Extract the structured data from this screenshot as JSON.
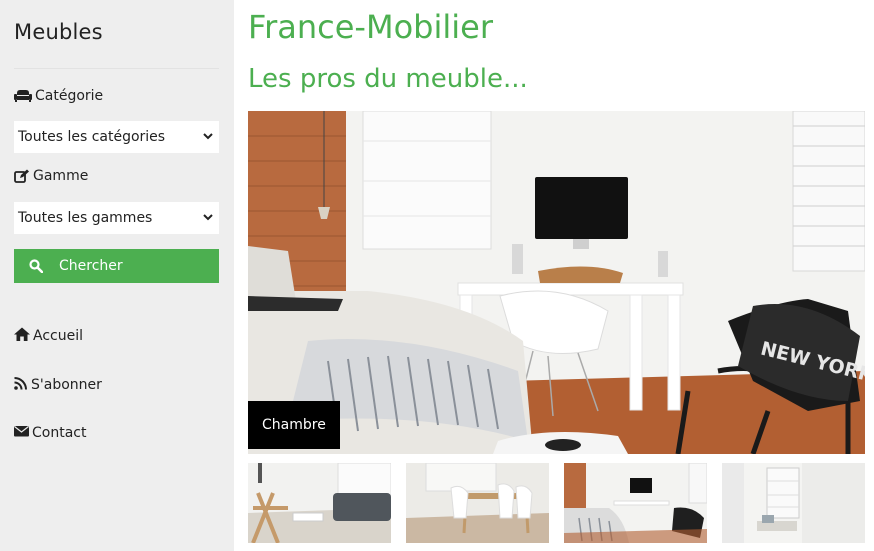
{
  "sidebar": {
    "brand": "Meubles",
    "category_label": "Catégorie",
    "category_select": "Toutes les catégories",
    "range_label": "Gamme",
    "range_select": "Toutes les gammes",
    "search_button": "Chercher",
    "nav": [
      {
        "label": "Accueil",
        "icon": "home-icon"
      },
      {
        "label": "S'abonner",
        "icon": "rss-icon"
      },
      {
        "label": "Contact",
        "icon": "envelope-icon"
      }
    ]
  },
  "main": {
    "title": "France-Mobilier",
    "subtitle": "Les pros du meuble...",
    "hero_caption": "Chambre"
  },
  "colors": {
    "accent": "#4caf50",
    "sidebar_bg": "#eeeeee",
    "caption_bg": "#000000"
  }
}
